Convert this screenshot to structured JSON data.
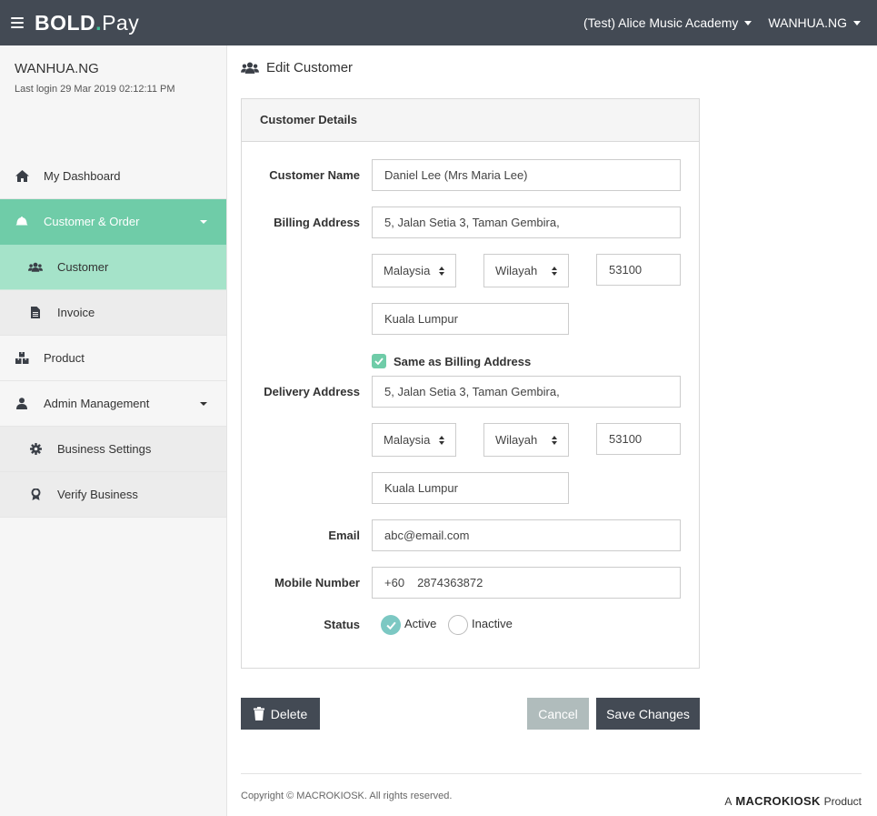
{
  "topbar": {
    "logo": {
      "part1": "BOLD",
      "dot": ".",
      "part2": "Pay"
    },
    "org_name": "(Test) Alice Music Academy",
    "user_name": "WANHUA.NG"
  },
  "sidebar": {
    "user_name": "WANHUA.NG",
    "last_login": "Last login 29 Mar 2019 02:12:11 PM",
    "items": [
      {
        "label": "My Dashboard",
        "icon": "home-icon"
      },
      {
        "label": "Customer & Order",
        "icon": "bell-icon"
      },
      {
        "label": "Customer",
        "icon": "users-icon"
      },
      {
        "label": "Invoice",
        "icon": "file-icon"
      },
      {
        "label": "Product",
        "icon": "boxes-icon"
      },
      {
        "label": "Admin Management",
        "icon": "user-icon"
      },
      {
        "label": "Business Settings",
        "icon": "gear-icon"
      },
      {
        "label": "Verify Business",
        "icon": "award-icon"
      }
    ]
  },
  "page": {
    "title": "Edit Customer",
    "card_title": "Customer Details",
    "form": {
      "customer_name_label": "Customer Name",
      "customer_name": "Daniel Lee (Mrs Maria Lee)",
      "billing_label": "Billing Address",
      "billing_address": "5, Jalan Setia 3, Taman Gembira,",
      "billing_country": "Malaysia",
      "billing_state": "Wilayah",
      "billing_postcode": "53100",
      "billing_city": "Kuala Lumpur",
      "same_as_billing_label": "Same as Billing Address",
      "delivery_label": "Delivery Address",
      "delivery_address": "5, Jalan Setia 3, Taman Gembira,",
      "delivery_country": "Malaysia",
      "delivery_state": "Wilayah",
      "delivery_postcode": "53100",
      "delivery_city": "Kuala Lumpur",
      "email_label": "Email",
      "email": "abc@email.com",
      "mobile_label": "Mobile Number",
      "mobile_code": "+60",
      "mobile_number": "2874363872",
      "status_label": "Status",
      "status_active": "Active",
      "status_inactive": "Inactive"
    },
    "buttons": {
      "delete": "Delete",
      "cancel": "Cancel",
      "save": "Save Changes"
    }
  },
  "footer": {
    "copyright": "Copyright © MACROKIOSK. All rights reserved.",
    "brand_prefix": "A",
    "brand_name": "MACROKIOSK",
    "brand_suffix": "Product"
  },
  "colors": {
    "topbar": "#434a54",
    "accent": "#6fcca8",
    "accent_light": "#a5e3c9"
  }
}
